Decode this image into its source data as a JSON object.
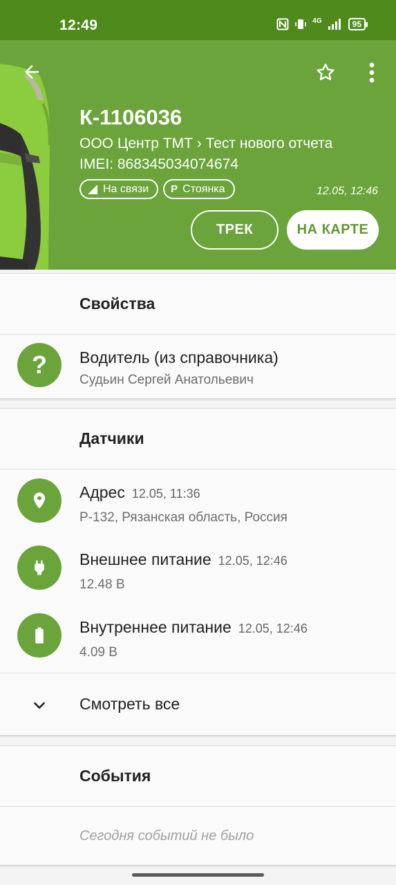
{
  "status_bar": {
    "time": "12:49",
    "network": "4G",
    "battery": "95"
  },
  "header": {
    "title": "К-1106036",
    "breadcrumb": "ООО Центр ТМТ › Тест нового отчета",
    "imei": "IMEI: 868345034074674",
    "chips": [
      {
        "icon": "signal-icon",
        "label": "На связи"
      },
      {
        "icon": "P",
        "label": "Стоянка"
      }
    ],
    "updated": "12.05, 12:46",
    "track_button": "ТРЕК",
    "map_button": "НА КАРТЕ"
  },
  "properties": {
    "title": "Свойства",
    "items": [
      {
        "icon": "question-icon",
        "title": "Водитель (из справочника)",
        "value": "Судьин Сергей Анатольевич"
      }
    ]
  },
  "sensors": {
    "title": "Датчики",
    "items": [
      {
        "icon": "location-pin-icon",
        "title": "Адрес",
        "time": "12.05, 11:36",
        "value": "Р-132, Рязанская область, Россия"
      },
      {
        "icon": "plug-icon",
        "title": "Внешнее питание",
        "time": "12.05, 12:46",
        "value": "12.48 В"
      },
      {
        "icon": "battery-icon",
        "title": "Внутреннее питание",
        "time": "12.05, 12:46",
        "value": "4.09 В"
      }
    ],
    "see_all": "Смотреть все"
  },
  "events": {
    "title": "События",
    "empty": "Сегодня событий не было"
  },
  "colors": {
    "status_bar": "#4f8a1d",
    "header": "#6aa43a",
    "accent": "#6aa43a"
  }
}
